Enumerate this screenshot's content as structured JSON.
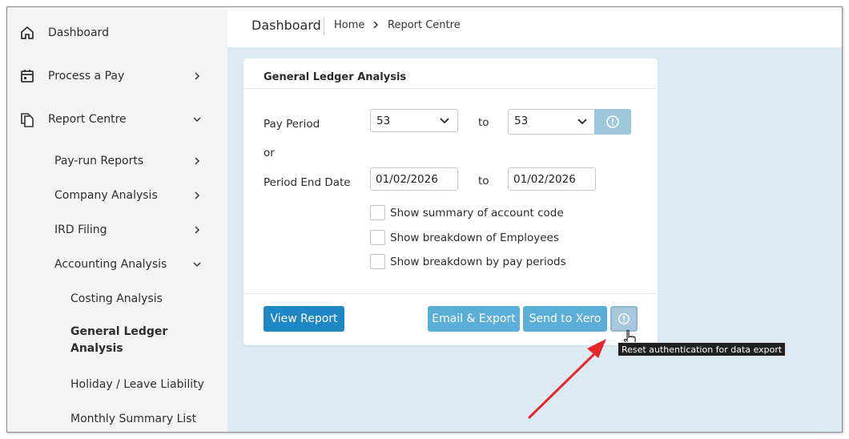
{
  "sidebar": {
    "items": [
      {
        "label": "Dashboard",
        "icon": "home-icon"
      },
      {
        "label": "Process a Pay",
        "icon": "calendar-icon"
      },
      {
        "label": "Report Centre",
        "icon": "documents-icon"
      },
      {
        "label": "Pay-run Reports"
      },
      {
        "label": "Company Analysis"
      },
      {
        "label": "IRD Filing"
      },
      {
        "label": "Accounting Analysis"
      },
      {
        "label": "Costing Analysis"
      },
      {
        "label": "General Ledger"
      },
      {
        "label": "Analysis"
      },
      {
        "label": "Holiday / Leave Liability"
      },
      {
        "label": "Monthly Summary List"
      }
    ]
  },
  "header": {
    "title": "Dashboard",
    "breadcrumb": [
      "Home",
      "Report Centre"
    ]
  },
  "card": {
    "title": "General Ledger Analysis",
    "pay_period_label": "Pay Period",
    "pay_period_from": "53",
    "to_label": "to",
    "pay_period_to": "53",
    "or_label": "or",
    "period_end_label": "Period End Date",
    "date_from": "01/02/2026",
    "date_to": "01/02/2026",
    "checkboxes": [
      "Show summary of account code",
      "Show breakdown of Employees",
      "Show breakdown by pay periods"
    ],
    "buttons": {
      "view_report": "View Report",
      "email_export": "Email & Export",
      "send_xero": "Send to Xero"
    }
  },
  "tooltip": "Reset authentication for data export",
  "colors": {
    "primary": "#1f87c4",
    "light_button": "#5aaed8",
    "main_bg": "#dcebf3",
    "arrow": "#e5262a"
  }
}
